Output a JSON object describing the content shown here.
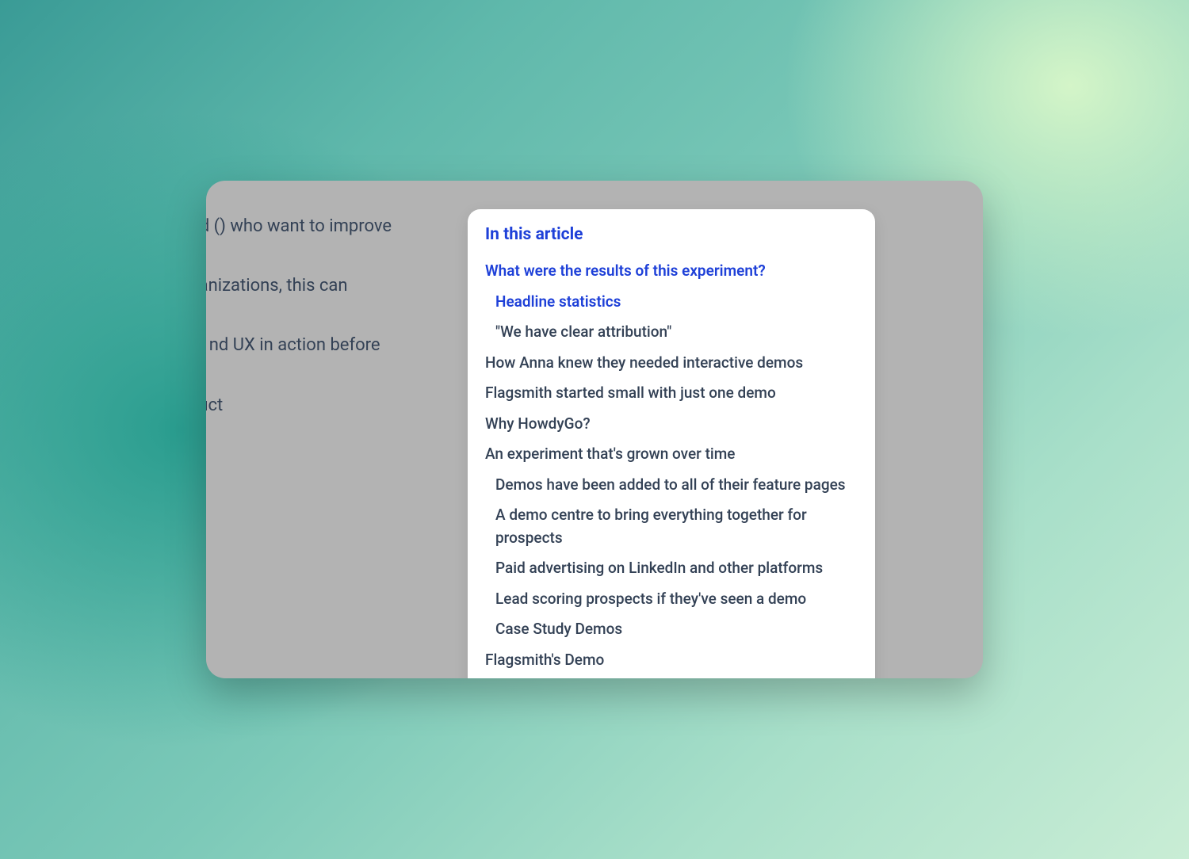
{
  "article": {
    "p1": "t led growth model and () who want to improve",
    "p2": "eads to a purchase rganizations, this can",
    "p3": "en made by a different nd UX in action before",
    "p4": "using interactive product"
  },
  "toc": {
    "title": "In this article",
    "items": [
      {
        "label": "What were the results of this experiment?",
        "level": 1,
        "active": true
      },
      {
        "label": "Headline statistics",
        "level": 2,
        "active": true
      },
      {
        "label": "\"We have clear attribution\"",
        "level": 2,
        "active": false
      },
      {
        "label": "How Anna knew they needed interactive demos",
        "level": 1,
        "active": false
      },
      {
        "label": "Flagsmith started small with just one demo",
        "level": 1,
        "active": false
      },
      {
        "label": "Why HowdyGo?",
        "level": 1,
        "active": false
      },
      {
        "label": "An experiment that's grown over time",
        "level": 1,
        "active": false
      },
      {
        "label": "Demos have been added to all of their feature pages",
        "level": 2,
        "active": false
      },
      {
        "label": "A demo centre to bring everything together for prospects",
        "level": 2,
        "active": false
      },
      {
        "label": "Paid advertising on LinkedIn and other platforms",
        "level": 2,
        "active": false
      },
      {
        "label": "Lead scoring prospects if they've seen a demo",
        "level": 2,
        "active": false
      },
      {
        "label": "Case Study Demos",
        "level": 2,
        "active": false
      },
      {
        "label": "Flagsmith's Demo",
        "level": 1,
        "active": false
      }
    ]
  }
}
